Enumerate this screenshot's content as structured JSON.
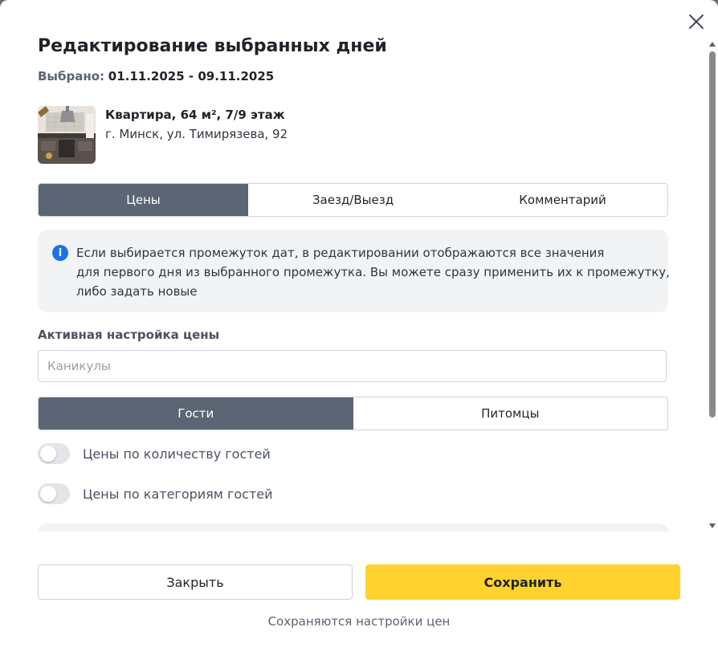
{
  "modal": {
    "title": "Редактирование выбранных дней",
    "selected_label": "Выбрано:",
    "selected_range": "01.11.2025 - 09.11.2025"
  },
  "listing": {
    "title": "Квартира, 64 м², 7/9 этаж",
    "address": "г. Минск, ул. Тимирязева, 92",
    "image_icon": "kitchen-photo"
  },
  "tabs": [
    {
      "label": "Цены",
      "active": true
    },
    {
      "label": "Заезд/Выезд",
      "active": false
    },
    {
      "label": "Комментарий",
      "active": false
    }
  ],
  "info": {
    "icon": "info-icon",
    "lines": [
      "Если выбирается промежуток дат, в редактировании отображаются все значения",
      "для первого дня из выбранного промежутка. Вы можете сразу применить их к промежутку,",
      "либо задать новые"
    ]
  },
  "price_setting": {
    "label": "Активная настройка цены",
    "value": "",
    "placeholder": "Каникулы"
  },
  "guest_tabs": [
    {
      "label": "Гости",
      "active": true
    },
    {
      "label": "Питомцы",
      "active": false
    }
  ],
  "toggles": [
    {
      "label": "Цены по количеству гостей",
      "on": false
    },
    {
      "label": "Цены по категориям гостей",
      "on": false
    }
  ],
  "footer": {
    "close_label": "Закрыть",
    "save_label": "Сохранить",
    "note": "Сохраняются настройки цен"
  },
  "colors": {
    "accent": "#ffd22e",
    "active_tab": "#5c6574",
    "info_icon": "#1a73e8"
  }
}
